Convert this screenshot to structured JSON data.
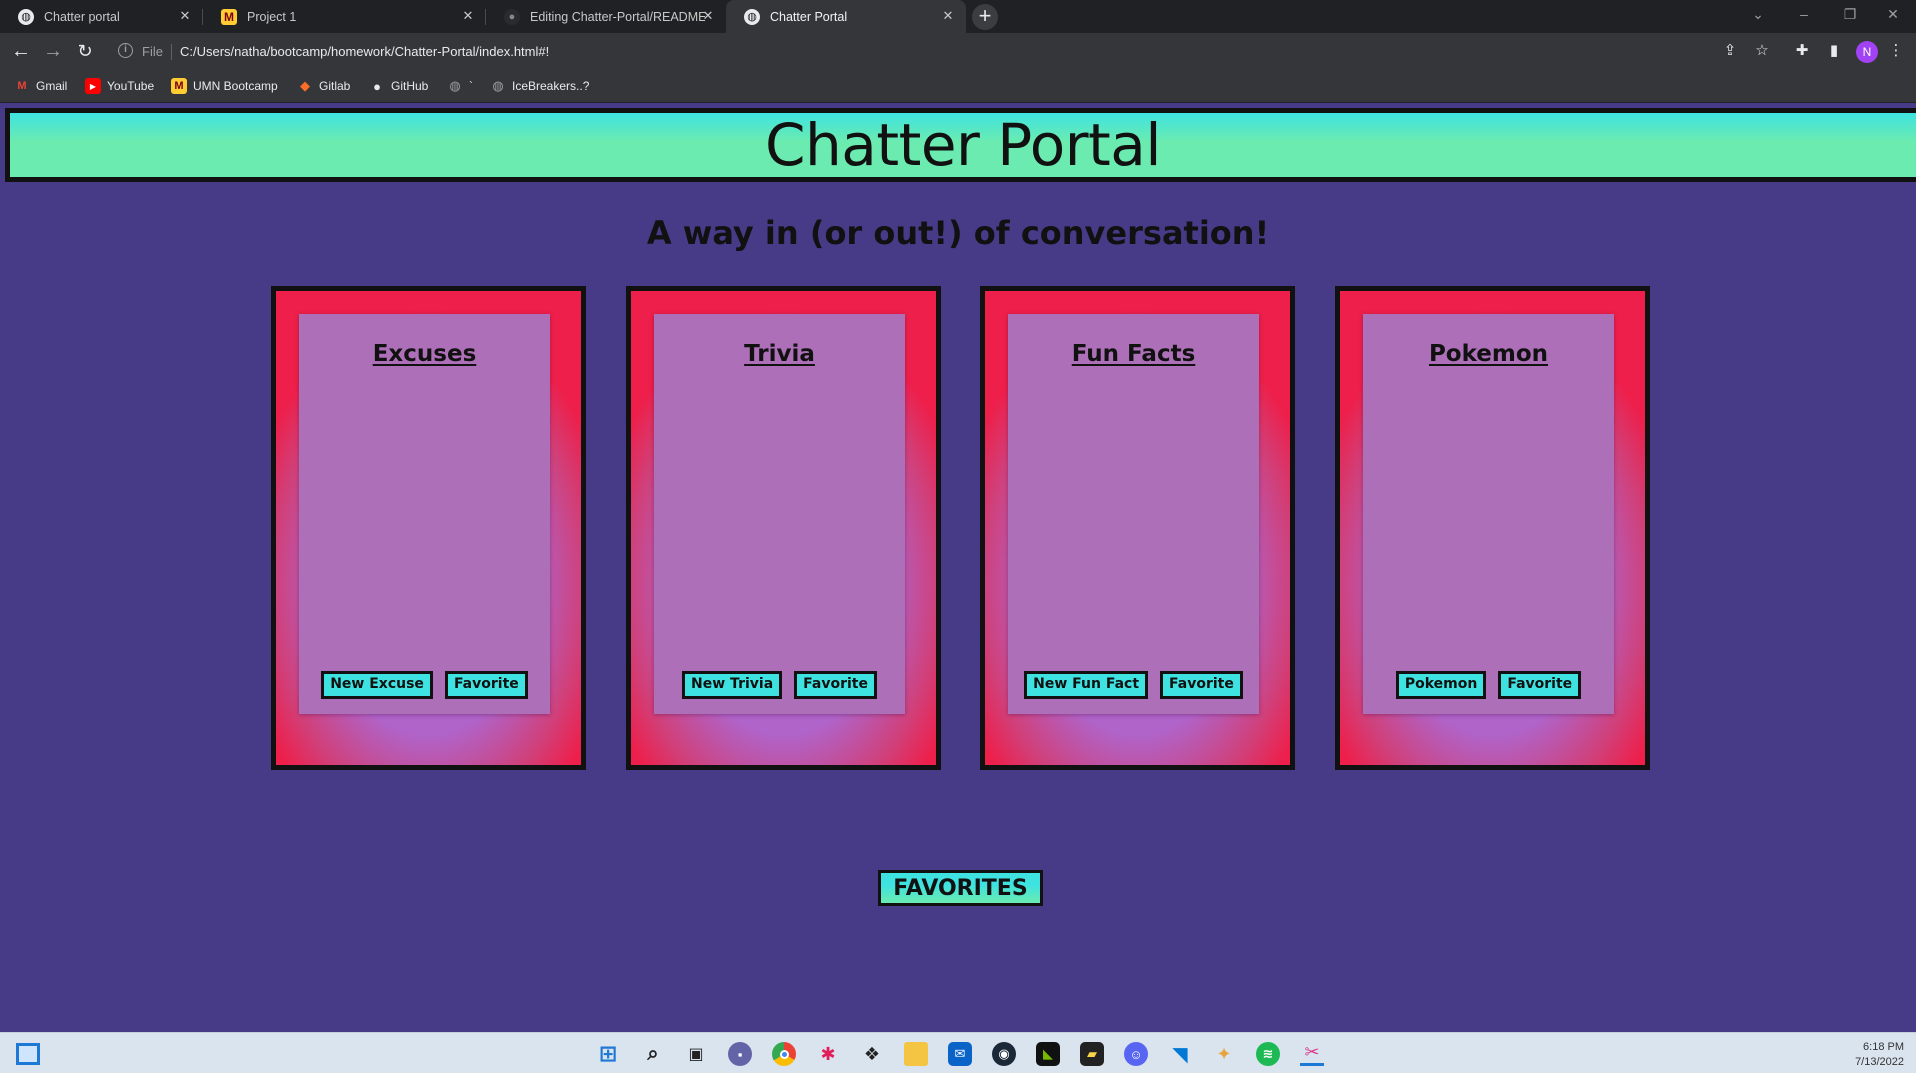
{
  "browser": {
    "tabs": [
      {
        "title": "Chatter portal",
        "favicon": "globe-icon",
        "active": false
      },
      {
        "title": "Project 1",
        "favicon": "umn-icon",
        "active": false
      },
      {
        "title": "Editing Chatter-Portal/README.n",
        "favicon": "github-icon",
        "active": false
      },
      {
        "title": "Chatter Portal",
        "favicon": "globe-icon",
        "active": true
      }
    ],
    "address": {
      "scheme_label": "File",
      "url": "C:/Users/natha/bootcamp/homework/Chatter-Portal/index.html#!"
    },
    "profile_initial": "N",
    "bookmarks": [
      {
        "label": "Gmail",
        "icon": "gmail-icon",
        "color": "#ea4335"
      },
      {
        "label": "YouTube",
        "icon": "youtube-icon",
        "color": "#ff0000"
      },
      {
        "label": "UMN Bootcamp",
        "icon": "umn-icon",
        "color": "#ffcc33"
      },
      {
        "label": "Gitlab",
        "icon": "gitlab-icon",
        "color": "#fc6d26"
      },
      {
        "label": "GitHub",
        "icon": "github-icon",
        "color": "#e8eaed"
      },
      {
        "label": "`",
        "icon": "globe-icon",
        "color": "#9aa0a6"
      },
      {
        "label": "IceBreakers..?",
        "icon": "globe-icon",
        "color": "#9aa0a6"
      }
    ]
  },
  "page": {
    "title": "Chatter Portal",
    "subtitle": "A way in (or out!) of conversation!",
    "cards": [
      {
        "title": "Excuses",
        "primary_button": "New Excuse",
        "favorite_button": "Favorite"
      },
      {
        "title": "Trivia",
        "primary_button": "New Trivia",
        "favorite_button": "Favorite"
      },
      {
        "title": "Fun Facts",
        "primary_button": "New Fun Fact",
        "favorite_button": "Favorite"
      },
      {
        "title": "Pokemon",
        "primary_button": "Pokemon",
        "favorite_button": "Favorite"
      }
    ],
    "favorites_button": "FAVORITES"
  },
  "taskbar": {
    "time": "6:18 PM",
    "date": "7/13/2022",
    "apps": [
      "windows-start-icon",
      "search-icon",
      "task-view-icon",
      "teams-chat-icon",
      "chrome-icon",
      "slack-icon",
      "dropbox-icon",
      "file-explorer-icon",
      "mail-icon",
      "steam-icon",
      "nvidia-icon",
      "sticky-notes-icon",
      "discord-icon",
      "vscode-icon",
      "sourcetree-icon",
      "spotify-icon",
      "snipping-tool-icon"
    ]
  },
  "colors": {
    "page_background": "#473b88",
    "banner_gradient_top": "#3ee3e0",
    "banner_gradient_bottom": "#6bebb0",
    "card_edge": "#ee1f4a",
    "card_inner": "#ad70b8",
    "button_fill": "#3ee2e0"
  }
}
